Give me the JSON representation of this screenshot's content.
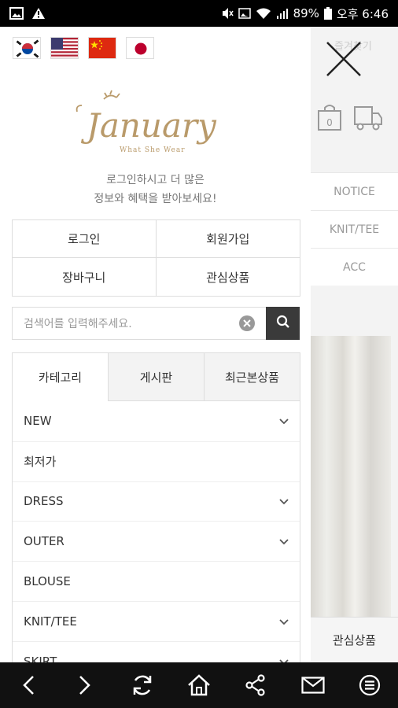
{
  "status_bar": {
    "battery": "89%",
    "time": "오후 6:46"
  },
  "flags": [
    "korea-flag",
    "usa-flag",
    "china-flag",
    "japan-flag"
  ],
  "logo": {
    "name": "January",
    "tagline": "What She Wear"
  },
  "login_message": {
    "line1": "로그인하시고 더 많은",
    "line2": "정보와 혜택을 받아보세요!"
  },
  "account_buttons": {
    "login": "로그인",
    "join": "회원가입",
    "cart": "장바구니",
    "wishlist": "관심상품"
  },
  "search": {
    "placeholder": "검색어를 입력해주세요."
  },
  "tabs": [
    {
      "label": "카테고리",
      "active": true
    },
    {
      "label": "게시판",
      "active": false
    },
    {
      "label": "최근본상품",
      "active": false
    }
  ],
  "categories": [
    {
      "label": "NEW",
      "has_children": true
    },
    {
      "label": "최저가",
      "has_children": false
    },
    {
      "label": "DRESS",
      "has_children": true
    },
    {
      "label": "OUTER",
      "has_children": true
    },
    {
      "label": "BLOUSE",
      "has_children": false
    },
    {
      "label": "KNIT/TEE",
      "has_children": true
    },
    {
      "label": "SKIRT",
      "has_children": true
    }
  ],
  "background_page": {
    "top_text": "즐겨찾기",
    "menu": [
      "NOTICE",
      "KNIT/TEE",
      "ACC"
    ],
    "wishlist_button": "관심상품"
  },
  "colors": {
    "logo_gold": "#b99a6a",
    "search_button": "#3a3a3a"
  }
}
